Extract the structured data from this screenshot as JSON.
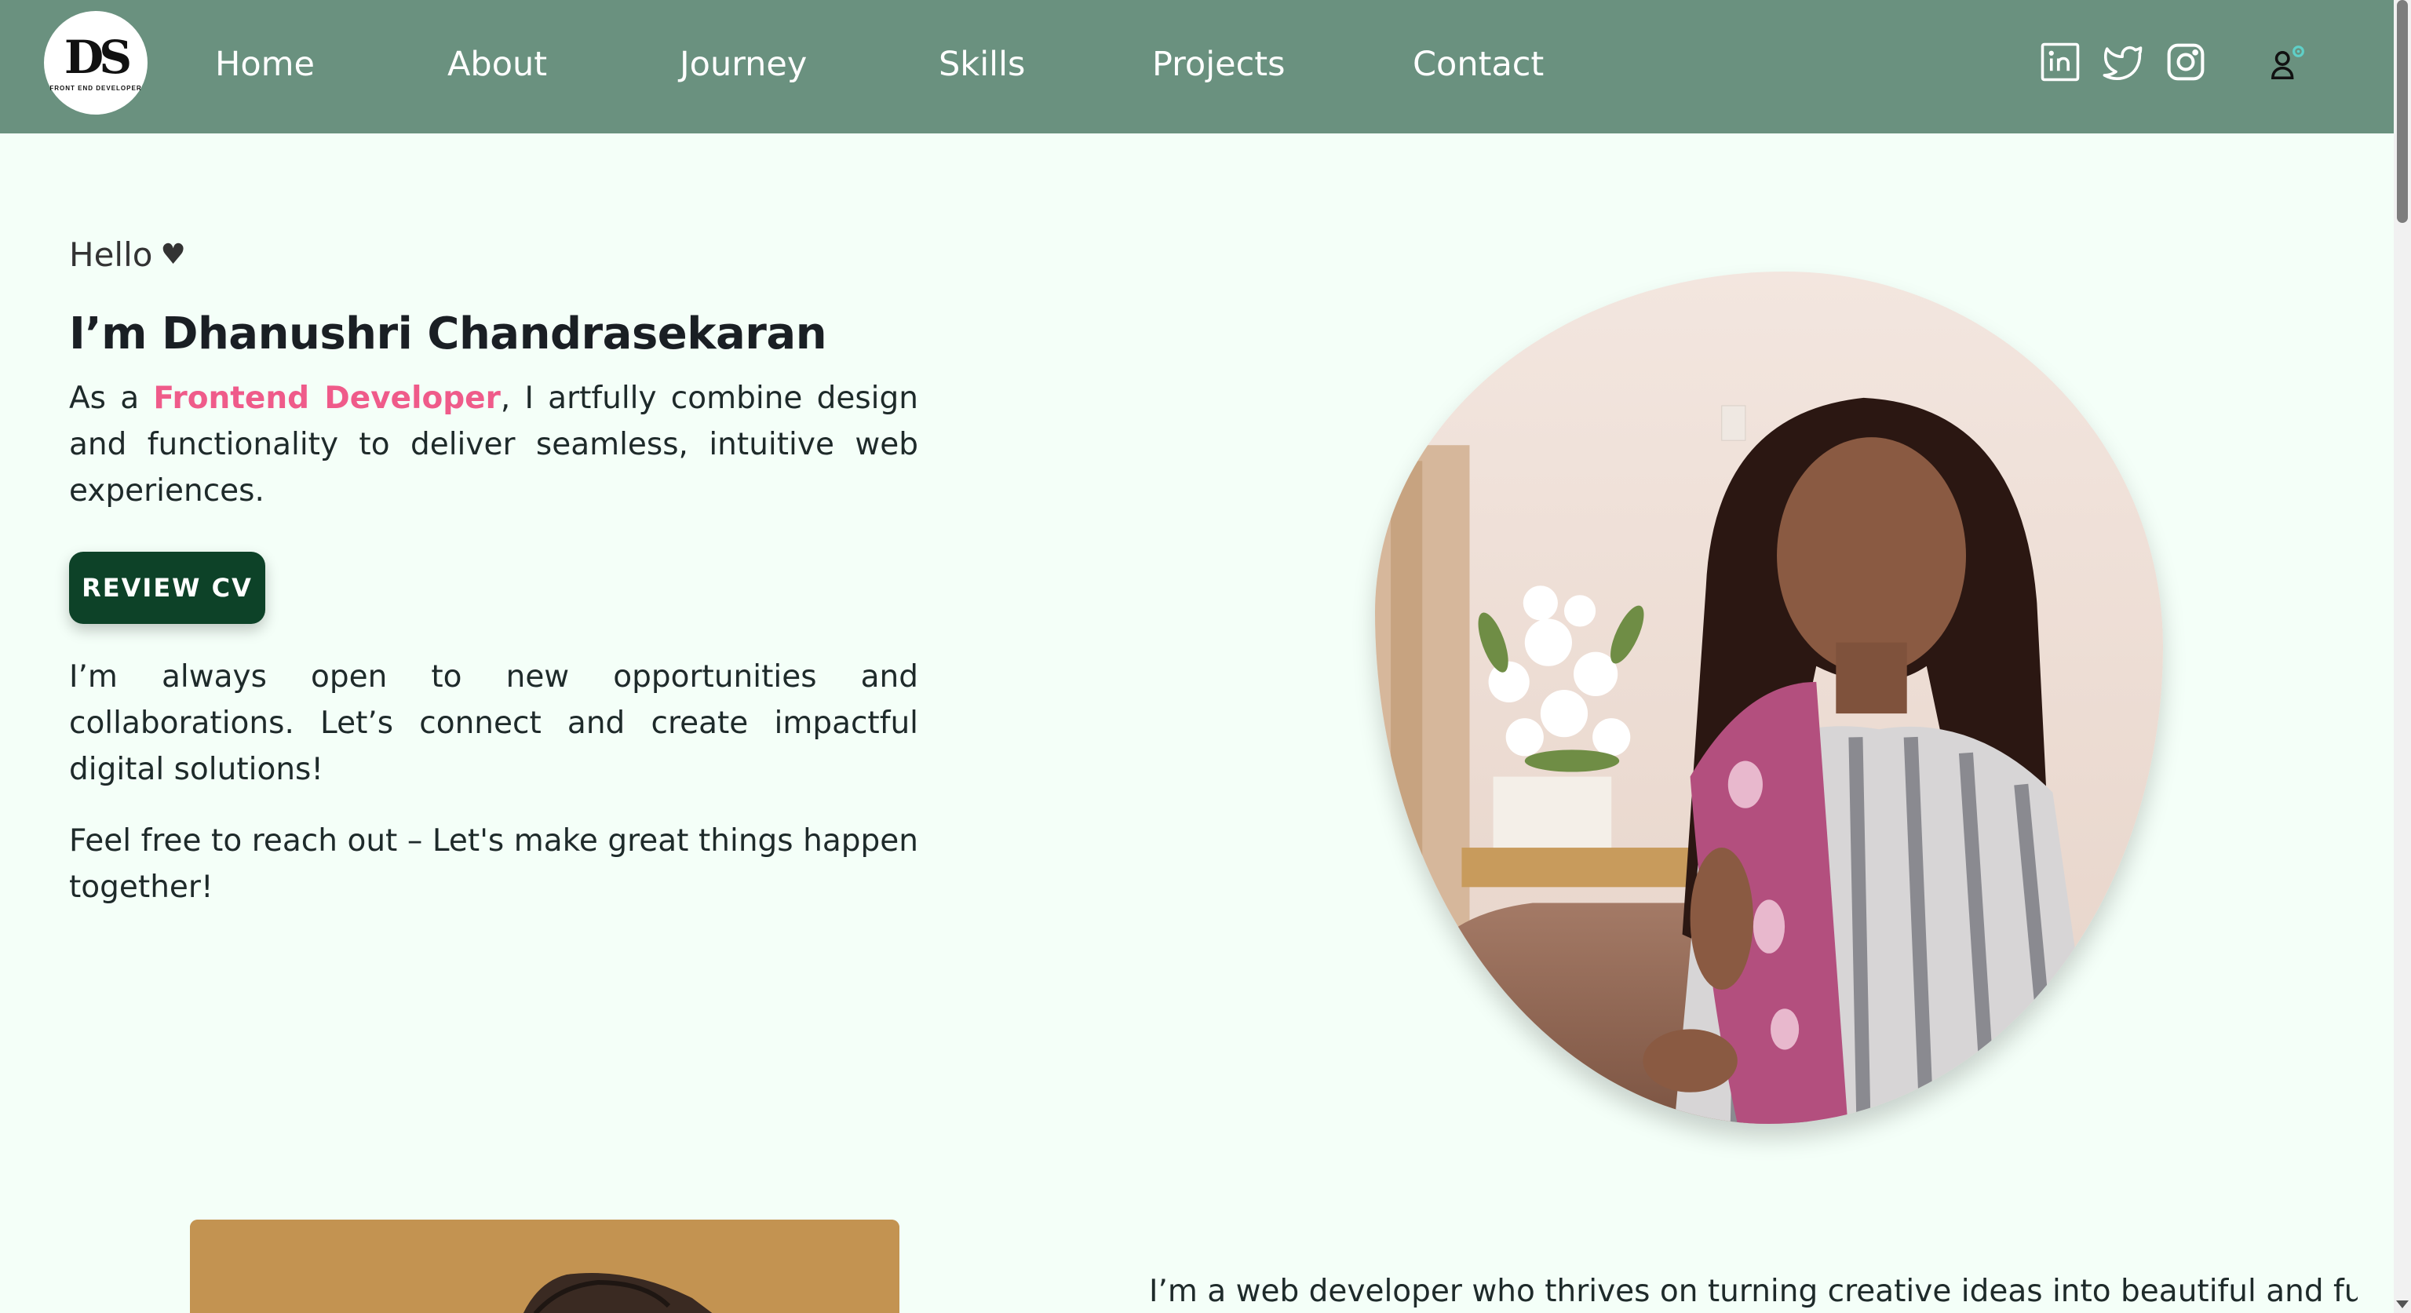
{
  "nav": {
    "logo_text": "DS",
    "logo_subtitle": "FRONT END DEVELOPER",
    "links": [
      "Home",
      "About",
      "Journey",
      "Skills",
      "Projects",
      "Contact"
    ],
    "social_icons": [
      "linkedin-icon",
      "twitter-icon",
      "instagram-icon",
      "user-settings-icon"
    ],
    "background_color": "#6a917f"
  },
  "hero": {
    "greeting": "Hello",
    "greeting_icon": "♥",
    "name": "I’m Dhanushri Chandrasekaran",
    "intro_prefix": "As a ",
    "intro_role": "Frontend Developer",
    "intro_suffix": ", I artfully combine design and functionality to deliver seamless, intuitive web experiences.",
    "cv_button": "REVIEW CV",
    "paragraph_1": "I’m always open to new opportunities and collaborations. Let’s connect and create impactful digital solutions!",
    "paragraph_2": "Feel free to reach out – Let's make great things happen together!"
  },
  "about": {
    "text": "I’m a web developer who thrives on turning creative ideas into beautiful and functional"
  },
  "colors": {
    "accent_pink": "#ef5b8a",
    "button_green": "#0d4228",
    "page_background": "#f4fff8"
  }
}
